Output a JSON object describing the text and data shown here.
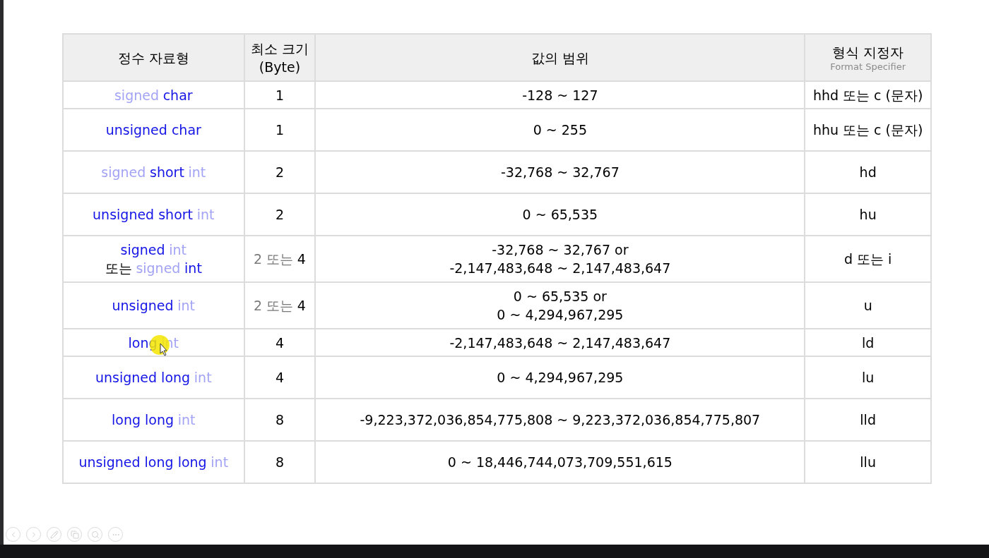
{
  "table": {
    "columns": [
      {
        "lines": [
          "정수 자료형"
        ]
      },
      {
        "lines": [
          "최소 크기",
          "(Byte)"
        ]
      },
      {
        "lines": [
          "값의 범위"
        ]
      },
      {
        "lines": [
          "형식 지정자"
        ],
        "subtitle": "Format Specifier"
      }
    ],
    "rows": [
      {
        "type": [
          [
            {
              "text": "signed",
              "color": "#a3a3f5"
            },
            {
              "text": "char",
              "color": "#1414e6"
            }
          ]
        ],
        "size": [
          {
            "text": "1",
            "color": "#000000"
          }
        ],
        "range": [
          "-128 ~ 127"
        ],
        "spec": "hhd 또는 c (문자)"
      },
      {
        "type": [
          [
            {
              "text": "unsigned char",
              "color": "#1414e6"
            }
          ]
        ],
        "size": [
          {
            "text": "1",
            "color": "#000000"
          }
        ],
        "range": [
          "0 ~ 255"
        ],
        "spec": "hhu 또는 c (문자)"
      },
      {
        "type": [
          [
            {
              "text": "signed",
              "color": "#a3a3f5"
            },
            {
              "text": "short",
              "color": "#1414e6"
            },
            {
              "text": "int",
              "color": "#a3a3f5"
            }
          ]
        ],
        "size": [
          {
            "text": "2",
            "color": "#000000"
          }
        ],
        "range": [
          "-32,768 ~ 32,767"
        ],
        "spec": "hd"
      },
      {
        "type": [
          [
            {
              "text": "unsigned short",
              "color": "#1414e6"
            },
            {
              "text": "int",
              "color": "#a3a3f5"
            }
          ]
        ],
        "size": [
          {
            "text": "2",
            "color": "#000000"
          }
        ],
        "range": [
          "0 ~ 65,535"
        ],
        "spec": "hu"
      },
      {
        "type": [
          [
            {
              "text": "signed",
              "color": "#1414e6"
            },
            {
              "text": "int",
              "color": "#a3a3f5"
            }
          ],
          [
            {
              "text": "또는",
              "color": "#000000"
            },
            {
              "text": "signed",
              "color": "#a3a3f5"
            },
            {
              "text": "int",
              "color": "#1414e6"
            }
          ]
        ],
        "size": [
          {
            "text": "2 또는",
            "color": "#7a7a7a"
          },
          {
            "text": "4",
            "color": "#000000"
          }
        ],
        "range": [
          "-32,768 ~ 32,767 or",
          "-2,147,483,648 ~ 2,147,483,647"
        ],
        "spec": "d 또는 i"
      },
      {
        "type": [
          [
            {
              "text": "unsigned",
              "color": "#1414e6"
            },
            {
              "text": "int",
              "color": "#a3a3f5"
            }
          ]
        ],
        "size": [
          {
            "text": "2 또는",
            "color": "#7a7a7a"
          },
          {
            "text": "4",
            "color": "#000000"
          }
        ],
        "range": [
          "0 ~ 65,535 or",
          "0 ~ 4,294,967,295"
        ],
        "spec": "u"
      },
      {
        "type": [
          [
            {
              "text": "long",
              "color": "#1414e6"
            },
            {
              "text": "int",
              "color": "#a3a3f5"
            }
          ]
        ],
        "size": [
          {
            "text": "4",
            "color": "#000000"
          }
        ],
        "range": [
          "-2,147,483,648 ~ 2,147,483,647"
        ],
        "spec": "ld"
      },
      {
        "type": [
          [
            {
              "text": "unsigned long",
              "color": "#1414e6"
            },
            {
              "text": "int",
              "color": "#a3a3f5"
            }
          ]
        ],
        "size": [
          {
            "text": "4",
            "color": "#000000"
          }
        ],
        "range": [
          "0 ~ 4,294,967,295"
        ],
        "spec": "lu"
      },
      {
        "type": [
          [
            {
              "text": "long long",
              "color": "#1414e6"
            },
            {
              "text": "int",
              "color": "#a3a3f5"
            }
          ]
        ],
        "size": [
          {
            "text": "8",
            "color": "#000000"
          }
        ],
        "range": [
          "-9,223,372,036,854,775,808 ~ 9,223,372,036,854,775,807"
        ],
        "spec": "lld"
      },
      {
        "type": [
          [
            {
              "text": "unsigned long long",
              "color": "#1414e6"
            },
            {
              "text": "int",
              "color": "#a3a3f5"
            }
          ]
        ],
        "size": [
          {
            "text": "8",
            "color": "#000000"
          }
        ],
        "range": [
          "0 ~ 18,446,744,073,709,551,615"
        ],
        "spec": "llu"
      }
    ]
  }
}
